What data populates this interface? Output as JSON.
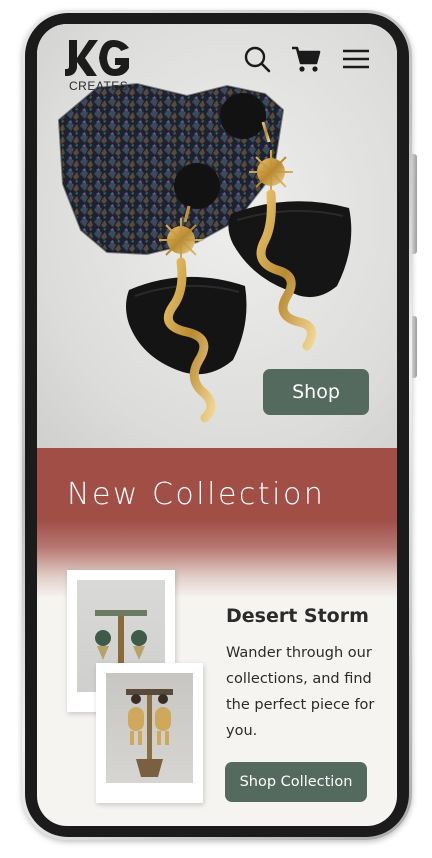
{
  "brand": {
    "logo_text": "KG",
    "tagline": "CREATES"
  },
  "header": {
    "icons": [
      "search-icon",
      "cart-icon",
      "menu-icon"
    ]
  },
  "hero": {
    "shop_label": "Shop"
  },
  "collection": {
    "heading": "New Collection",
    "title": "Desert Storm",
    "description": "Wander through our collections, and find the perfect piece for you.",
    "button_label": "Shop Collection"
  },
  "colors": {
    "accent_green": "#546a5f",
    "band_red": "#a14e47",
    "page_bg": "#f6f4f0"
  }
}
